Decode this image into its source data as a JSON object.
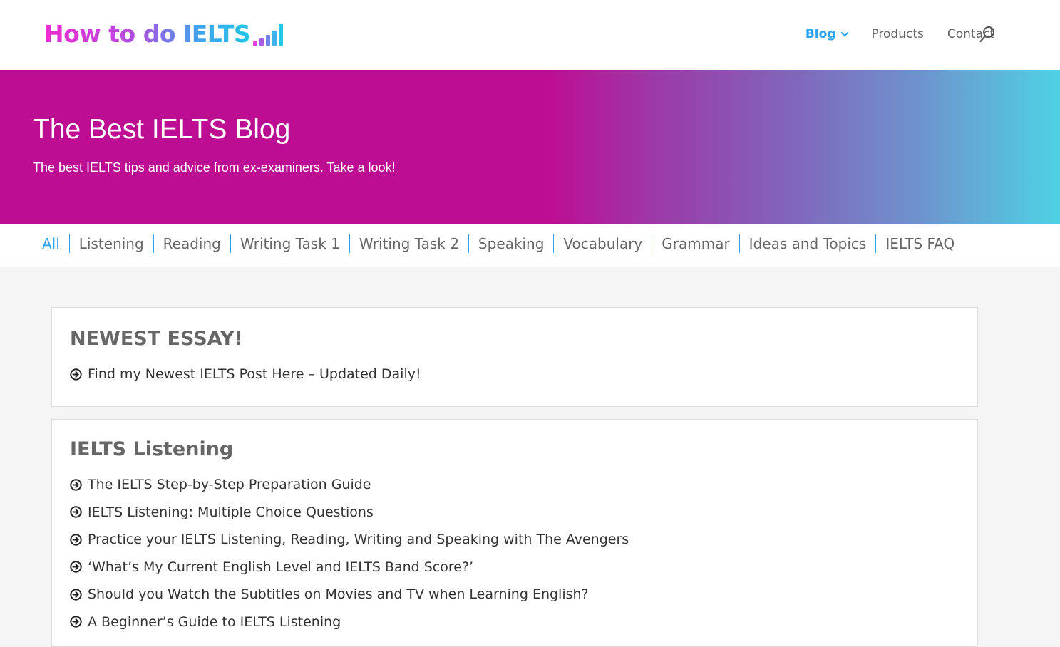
{
  "header": {
    "logo_text": "How to do IELTS",
    "logo_bar_colors": [
      "#e23fd6",
      "#a35be4",
      "#6f86ea",
      "#3db3ee",
      "#22c7e6"
    ],
    "nav": [
      {
        "label": "Blog",
        "active": true,
        "has_dropdown": true
      },
      {
        "label": "Products"
      },
      {
        "label": "Contact"
      }
    ],
    "search_icon": "search-icon"
  },
  "hero": {
    "title": "The Best IELTS Blog",
    "subtitle": "The best IELTS tips and advice from ex-examiners. Take a look!"
  },
  "filters": [
    "All",
    "Listening",
    "Reading",
    "Writing Task 1",
    "Writing Task 2",
    "Speaking",
    "Vocabulary",
    "Grammar",
    "Ideas and Topics",
    "IELTS FAQ"
  ],
  "active_filter": "All",
  "cards": [
    {
      "title": "NEWEST ESSAY!",
      "links": [
        "Find my Newest IELTS Post Here – Updated Daily!"
      ]
    },
    {
      "title": "IELTS Listening",
      "links": [
        "The IELTS Step-by-Step Preparation Guide",
        "IELTS Listening: Multiple Choice Questions",
        "Practice your IELTS Listening, Reading, Writing and Speaking with The Avengers",
        "‘What’s My Current English Level and IELTS Band Score?’",
        "Should you Watch the Subtitles on Movies and TV when Learning English?",
        "A Beginner’s Guide to IELTS Listening"
      ]
    }
  ],
  "colors": {
    "accent": "#2ea3f2",
    "hero_start": "#bd0e93",
    "hero_end": "#4ed2e4",
    "text": "#666666"
  }
}
